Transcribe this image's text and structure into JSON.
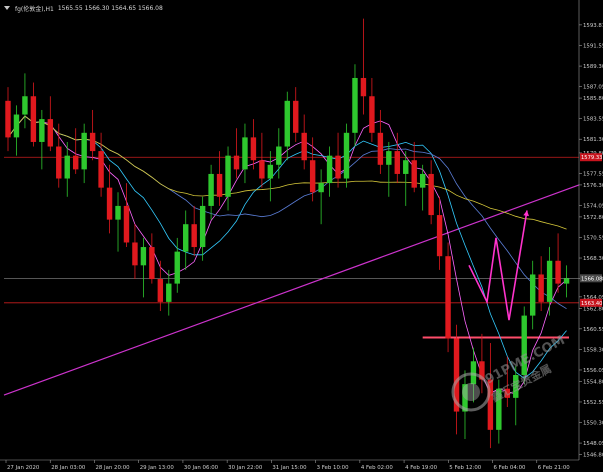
{
  "chart_header": {
    "symbol_label": "fg(伦敦金),H1",
    "ohlc": "1565.55 1566.30 1564.65 1566.08"
  },
  "chart_data": {
    "type": "candlestick",
    "timeframe": "H1",
    "ylim": [
      1546.2,
      1595.0
    ],
    "y_ticks": [
      "1593.81",
      "1591.55",
      "1589.30",
      "1587.05",
      "1585.80",
      "1583.55",
      "1581.30",
      "1579.80",
      "1577.55",
      "1576.30",
      "1574.05",
      "1572.80",
      "1570.55",
      "1568.30",
      "1566.08",
      "1564.05",
      "1562.80",
      "1560.55",
      "1558.30",
      "1556.05",
      "1554.80",
      "1552.55",
      "1550.30",
      "1548.05",
      "1546.80"
    ],
    "x_ticks": [
      "27 Jan 2020",
      "28 Jan 03:00",
      "28 Jan 20:00",
      "29 Jan 13:00",
      "30 Jan 06:00",
      "30 Jan 22:00",
      "31 Jan 15:00",
      "3 Feb 10:00",
      "4 Feb 02:00",
      "4 Feb 19:00",
      "5 Feb 12:00",
      "6 Feb 04:00",
      "6 Feb 21:00"
    ],
    "current_price": "1566.08",
    "resistance_level": "1579.33",
    "support_level": "1563.40",
    "candles": [
      [
        1585.5,
        1587.0,
        1580.0,
        1581.5
      ],
      [
        1581.5,
        1585.0,
        1579.5,
        1584.0
      ],
      [
        1584.0,
        1588.5,
        1582.5,
        1586.0
      ],
      [
        1586.0,
        1587.5,
        1580.5,
        1581.0
      ],
      [
        1581.0,
        1584.5,
        1578.0,
        1583.5
      ],
      [
        1583.5,
        1586.0,
        1580.0,
        1580.5
      ],
      [
        1580.5,
        1583.0,
        1576.0,
        1577.0
      ],
      [
        1577.0,
        1581.0,
        1575.0,
        1579.5
      ],
      [
        1579.5,
        1582.5,
        1577.5,
        1578.0
      ],
      [
        1578.0,
        1583.0,
        1576.5,
        1582.0
      ],
      [
        1582.0,
        1584.5,
        1579.0,
        1580.0
      ],
      [
        1580.0,
        1582.0,
        1575.0,
        1576.0
      ],
      [
        1576.0,
        1578.5,
        1571.0,
        1572.5
      ],
      [
        1572.5,
        1575.5,
        1569.0,
        1574.0
      ],
      [
        1574.0,
        1576.5,
        1569.5,
        1570.0
      ],
      [
        1570.0,
        1572.0,
        1566.0,
        1567.5
      ],
      [
        1567.5,
        1570.5,
        1564.0,
        1569.5
      ],
      [
        1569.5,
        1571.0,
        1565.5,
        1566.0
      ],
      [
        1566.0,
        1568.0,
        1562.5,
        1563.5
      ],
      [
        1563.5,
        1567.0,
        1562.0,
        1565.5
      ],
      [
        1565.5,
        1570.5,
        1564.5,
        1569.0
      ],
      [
        1569.0,
        1573.5,
        1567.0,
        1572.0
      ],
      [
        1572.0,
        1574.0,
        1568.5,
        1569.5
      ],
      [
        1569.5,
        1575.0,
        1568.0,
        1574.0
      ],
      [
        1574.0,
        1578.5,
        1572.5,
        1577.5
      ],
      [
        1577.5,
        1580.0,
        1574.0,
        1575.0
      ],
      [
        1575.0,
        1580.5,
        1573.5,
        1579.5
      ],
      [
        1579.5,
        1582.5,
        1577.0,
        1578.0
      ],
      [
        1578.0,
        1583.0,
        1576.5,
        1581.5
      ],
      [
        1581.5,
        1583.5,
        1578.0,
        1579.0
      ],
      [
        1579.0,
        1582.0,
        1576.0,
        1577.0
      ],
      [
        1577.0,
        1580.0,
        1574.5,
        1578.5
      ],
      [
        1578.5,
        1582.5,
        1577.0,
        1580.5
      ],
      [
        1580.5,
        1586.5,
        1579.0,
        1585.5
      ],
      [
        1585.5,
        1587.0,
        1581.0,
        1582.0
      ],
      [
        1582.0,
        1584.0,
        1578.0,
        1579.0
      ],
      [
        1579.0,
        1581.5,
        1574.5,
        1575.5
      ],
      [
        1575.5,
        1578.0,
        1572.0,
        1576.5
      ],
      [
        1576.5,
        1580.5,
        1575.0,
        1579.5
      ],
      [
        1579.5,
        1582.0,
        1576.0,
        1577.0
      ],
      [
        1577.0,
        1583.0,
        1576.0,
        1582.0
      ],
      [
        1582.0,
        1589.5,
        1580.5,
        1588.0
      ],
      [
        1588.0,
        1594.5,
        1584.0,
        1586.0
      ],
      [
        1586.0,
        1588.0,
        1581.0,
        1582.0
      ],
      [
        1582.0,
        1584.5,
        1577.5,
        1578.5
      ],
      [
        1578.5,
        1581.0,
        1575.0,
        1580.0
      ],
      [
        1580.0,
        1582.0,
        1576.5,
        1577.5
      ],
      [
        1577.5,
        1580.0,
        1574.0,
        1579.0
      ],
      [
        1579.0,
        1581.0,
        1575.5,
        1576.0
      ],
      [
        1576.0,
        1578.5,
        1573.5,
        1577.5
      ],
      [
        1577.5,
        1579.0,
        1572.0,
        1573.0
      ],
      [
        1573.0,
        1575.0,
        1567.0,
        1568.5
      ],
      [
        1568.5,
        1570.0,
        1558.0,
        1559.5
      ],
      [
        1559.5,
        1561.0,
        1549.0,
        1551.5
      ],
      [
        1551.5,
        1556.0,
        1548.5,
        1554.5
      ],
      [
        1554.5,
        1558.5,
        1552.5,
        1557.0
      ],
      [
        1557.0,
        1560.0,
        1553.5,
        1555.0
      ],
      [
        1555.0,
        1559.0,
        1547.5,
        1549.5
      ],
      [
        1549.5,
        1555.0,
        1548.0,
        1554.0
      ],
      [
        1554.0,
        1557.5,
        1552.0,
        1553.0
      ],
      [
        1553.0,
        1556.5,
        1550.0,
        1555.5
      ],
      [
        1555.5,
        1563.0,
        1554.5,
        1562.0
      ],
      [
        1562.0,
        1568.0,
        1560.5,
        1566.5
      ],
      [
        1566.5,
        1568.5,
        1562.5,
        1563.5
      ],
      [
        1563.5,
        1569.5,
        1562.0,
        1568.0
      ],
      [
        1568.0,
        1571.0,
        1564.5,
        1565.5
      ],
      [
        1565.5,
        1567.5,
        1564.0,
        1566.08
      ]
    ]
  },
  "colors": {
    "background": "#000000",
    "bull": "#2ec82e",
    "bear": "#e0191e",
    "grid_line": "#c81e1e",
    "trendline": "#cc33cc",
    "price_tag": "#c8141e",
    "arrow": "#ff33cc"
  },
  "watermark": {
    "site": "91PME.COM",
    "brand": "鑫汇宝贵金属"
  }
}
